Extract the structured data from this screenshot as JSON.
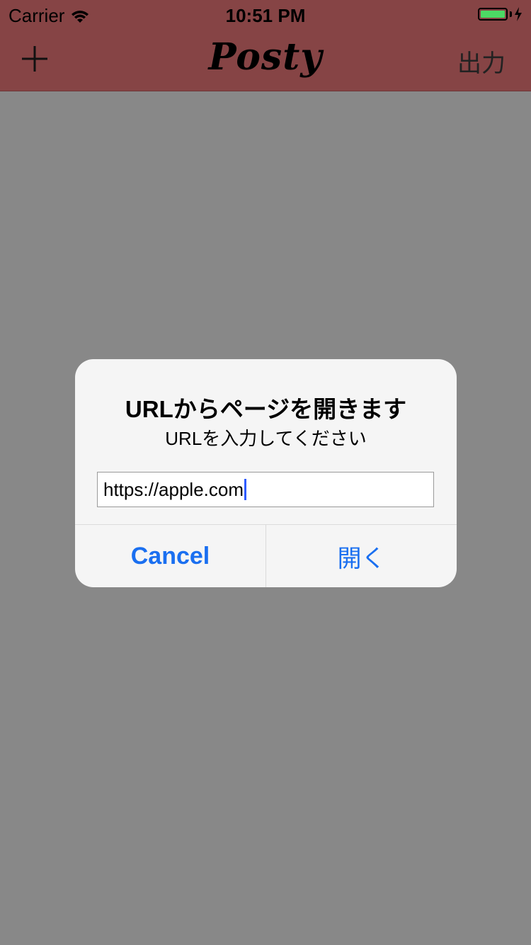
{
  "status_bar": {
    "carrier": "Carrier",
    "time": "10:51 PM",
    "battery_color": "#4cd964",
    "battery_level": 1.0
  },
  "nav_bar": {
    "background": "#864445",
    "add_icon": "plus-icon",
    "title": "Posty",
    "export_label": "出力"
  },
  "alert": {
    "title": "URLからページを開きます",
    "message": "URLを入力してください",
    "input_value": "https://apple.com",
    "cancel_label": "Cancel",
    "open_label": "開く",
    "button_color": "#1a6ff0"
  },
  "overlay_color": "#888888"
}
